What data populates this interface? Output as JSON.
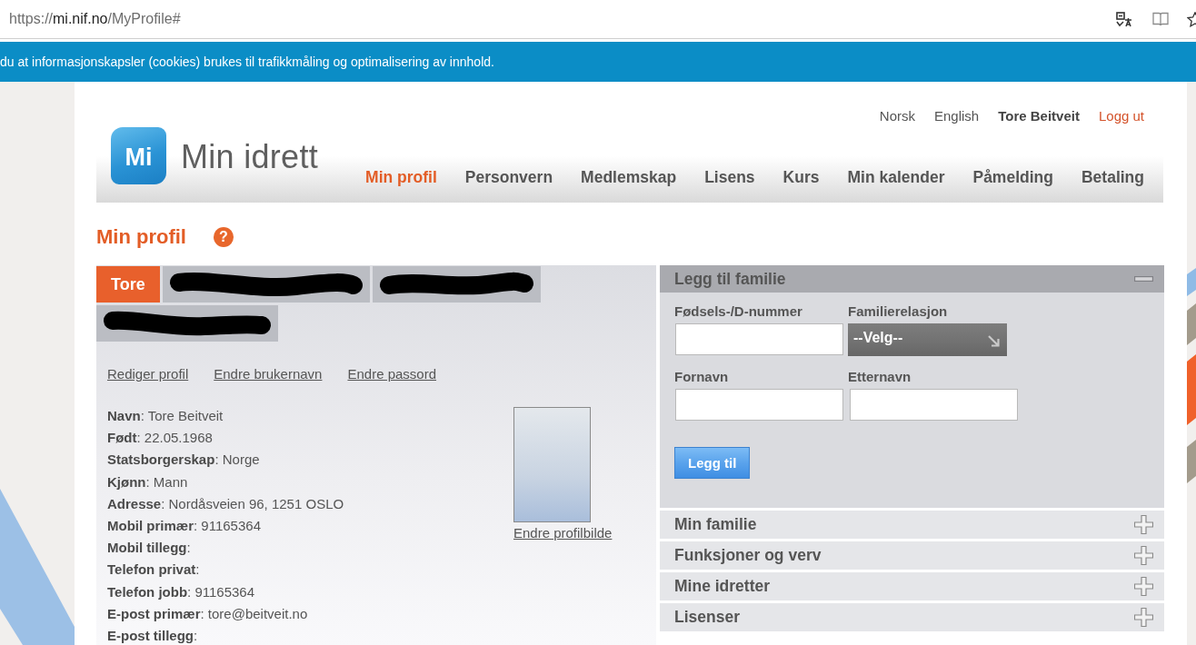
{
  "browser": {
    "url": {
      "scheme": "https://",
      "host": "mi.nif.no",
      "path": "/MyProfile#"
    }
  },
  "cookie_banner": {
    "text": "du at informasjonskapsler (cookies) brukes til trafikkmåling og optimalisering av innhold."
  },
  "header": {
    "logo": {
      "mark": "Mi",
      "name": "Min idrett"
    },
    "top_links": [
      {
        "label": "Norsk",
        "kind": "language"
      },
      {
        "label": "English",
        "kind": "language"
      },
      {
        "label": "Tore Beitveit",
        "kind": "user"
      },
      {
        "label": "Logg ut",
        "kind": "logout"
      }
    ],
    "nav": [
      {
        "label": "Min profil",
        "selected": true
      },
      {
        "label": "Personvern",
        "selected": false
      },
      {
        "label": "Medlemskap",
        "selected": false
      },
      {
        "label": "Lisens",
        "selected": false
      },
      {
        "label": "Kurs",
        "selected": false
      },
      {
        "label": "Min kalender",
        "selected": false
      },
      {
        "label": "Påmelding",
        "selected": false
      },
      {
        "label": "Betaling",
        "selected": false
      }
    ]
  },
  "page": {
    "title": "Min profil",
    "help": "?"
  },
  "profile": {
    "tabs": [
      {
        "kind": "label",
        "label": "Tore",
        "selected": true
      },
      {
        "kind": "redacted",
        "selected": false
      },
      {
        "kind": "redacted",
        "selected": false
      },
      {
        "kind": "redacted",
        "selected": false
      }
    ],
    "links": [
      "Rediger profil",
      "Endre brukernavn",
      "Endre passord"
    ],
    "fields": [
      "**Navn**: Tore Beitveit",
      "**Født**: 22.05.1968",
      "**Statsborgerskap**: Norge",
      "**Kjønn**: Mann",
      "**Adresse**: Nordåsveien 96, 1251 OSLO",
      "**Mobil primær**: 91165364",
      "**Mobil tillegg**:",
      "**Telefon privat**:",
      "**Telefon jobb**: 91165364",
      "**E-post primær**: tore@beitveit.no",
      "**E-post tillegg**:"
    ],
    "photo_link": "Endre profilbilde"
  },
  "family": {
    "sections": [
      {
        "title": "Legg til familie",
        "expanded": true,
        "form": {
          "fields": [
            {
              "label": "Fødsels-/D-nummer",
              "kind": "text"
            },
            {
              "label": "Familierelasjon",
              "kind": "select",
              "value": "--Velg--"
            },
            {
              "label": "Fornavn",
              "kind": "text"
            },
            {
              "label": "Etternavn",
              "kind": "text"
            }
          ],
          "submit": "Legg til"
        }
      },
      {
        "title": "Min familie",
        "expanded": false
      },
      {
        "title": "Funksjoner og verv",
        "expanded": false
      },
      {
        "title": "Mine idretter",
        "expanded": false
      },
      {
        "title": "Lisenser",
        "expanded": false
      }
    ]
  }
}
